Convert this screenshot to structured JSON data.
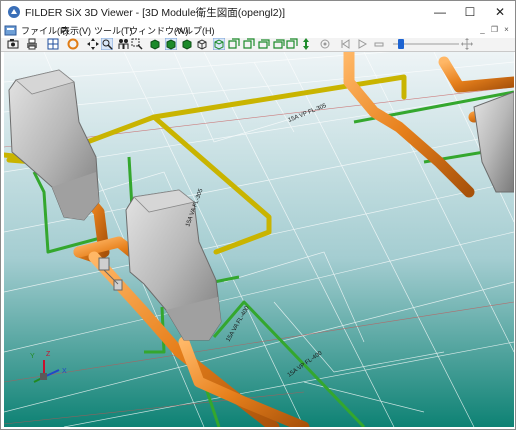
{
  "window": {
    "title": "FILDER SiX 3D Viewer - [3D Module衛生図面(opengl2)]",
    "minimize_glyph": "—",
    "maximize_glyph": "☐",
    "close_glyph": "✕"
  },
  "menu": {
    "items": [
      {
        "label": "ファイル(F)"
      },
      {
        "label": "表示(V)"
      },
      {
        "label": "ツール(T)"
      },
      {
        "label": "ウィンドウ(W)"
      },
      {
        "label": "ヘルプ(H)"
      }
    ],
    "mdi_minimize": "_",
    "mdi_restore": "❐",
    "mdi_close": "×"
  },
  "toolbar": {
    "slider_value_fraction": 0.12
  },
  "viewport": {
    "pipe_labels": [
      {
        "text": "15A VP FL-305"
      },
      {
        "text": "15A VA FL-305"
      },
      {
        "text": "15A VA FL-400"
      },
      {
        "text": "15A VP FL-400"
      }
    ],
    "axis_labels": {
      "x": "X",
      "y": "Y",
      "z": "Z"
    },
    "colors": {
      "sky_top": "#eef4f6",
      "sky_bottom": "#0e8274",
      "drain_pipe": "#e7801c",
      "hot_pipe": "#c9b400",
      "water_pipe": "#34a72e",
      "fixture": "#b8b8b8"
    }
  }
}
